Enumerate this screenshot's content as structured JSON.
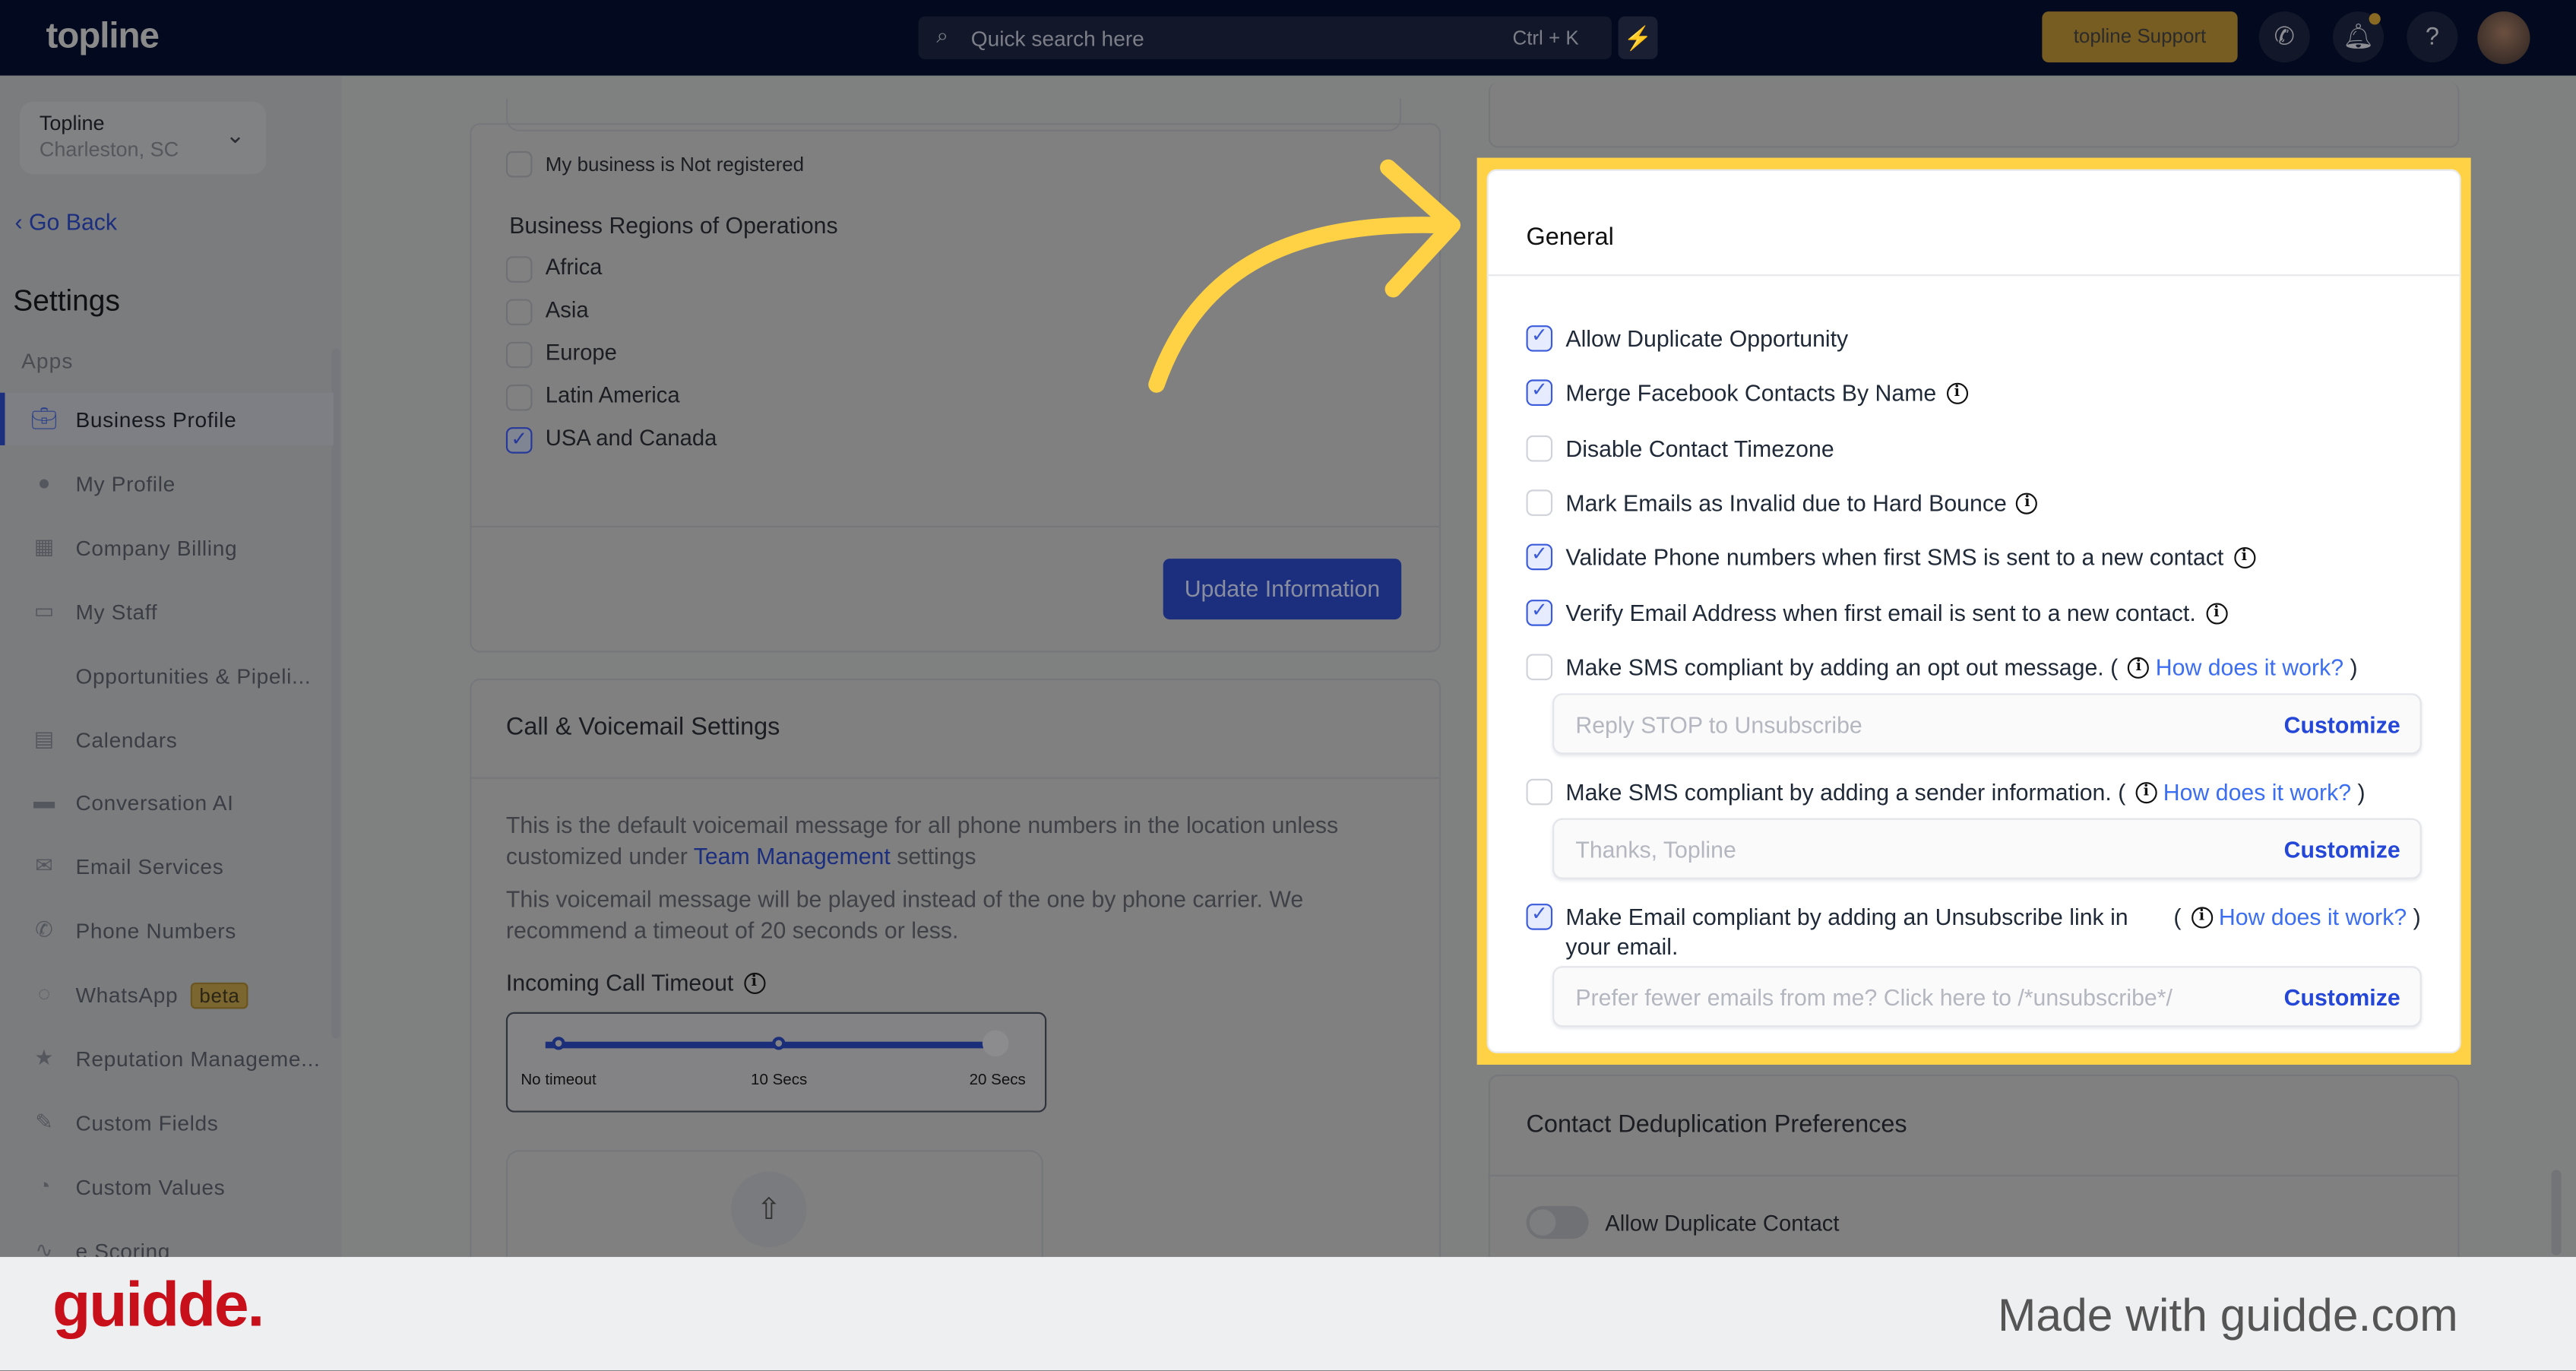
{
  "header": {
    "logo": "topline",
    "search_placeholder": "Quick search here",
    "search_shortcut": "Ctrl + K",
    "support_label": "topline Support",
    "icons": [
      "search-icon",
      "lightning-icon",
      "phone-icon",
      "bell-icon",
      "help-icon",
      "avatar"
    ]
  },
  "sidebar": {
    "location_name": "Topline",
    "location_city": "Charleston, SC",
    "go_back": "Go Back",
    "title": "Settings",
    "section": "Apps",
    "items": [
      {
        "label": "Business Profile",
        "icon": "briefcase-icon",
        "active": true
      },
      {
        "label": "My Profile",
        "icon": "user-icon"
      },
      {
        "label": "Company Billing",
        "icon": "calculator-icon"
      },
      {
        "label": "My Staff",
        "icon": "inbox-icon"
      },
      {
        "label": "Opportunities & Pipeli...",
        "icon": ""
      },
      {
        "label": "Calendars",
        "icon": "calendar-icon"
      },
      {
        "label": "Conversation AI",
        "icon": "chat-icon"
      },
      {
        "label": "Email Services",
        "icon": "mail-icon"
      },
      {
        "label": "Phone Numbers",
        "icon": "phone-icon"
      },
      {
        "label": "WhatsApp",
        "icon": "whatsapp-icon",
        "badge": "beta"
      },
      {
        "label": "Reputation Manageme...",
        "icon": "star-icon"
      },
      {
        "label": "Custom Fields",
        "icon": "edit-field-icon"
      },
      {
        "label": "Custom Values",
        "icon": "pie-icon"
      },
      {
        "label": "e Scoring",
        "icon": "chart-icon"
      }
    ]
  },
  "business": {
    "not_registered": "My business is Not registered",
    "regions_title": "Business Regions of Operations",
    "regions": [
      {
        "label": "Africa",
        "checked": false
      },
      {
        "label": "Asia",
        "checked": false
      },
      {
        "label": "Europe",
        "checked": false
      },
      {
        "label": "Latin America",
        "checked": false
      },
      {
        "label": "USA and Canada",
        "checked": true
      }
    ],
    "update_button": "Update Information"
  },
  "call": {
    "title": "Call & Voicemail Settings",
    "p1_a": "This is the default voicemail message for all phone numbers in the location unless customized under",
    "p1_link": "Team Management",
    "p1_b": "settings",
    "p2": "This voicemail message will be played instead of the one by phone carrier. We recommend a timeout of 20 seconds or less.",
    "timeout_label": "Incoming Call Timeout",
    "ticks": [
      "No timeout",
      "10 Secs",
      "20 Secs"
    ],
    "timeout_value": "20 Secs"
  },
  "general": {
    "title": "General",
    "options": [
      {
        "label": "Allow Duplicate Opportunity",
        "checked": true
      },
      {
        "label": "Merge Facebook Contacts By Name",
        "checked": true,
        "info": true
      },
      {
        "label": "Disable Contact Timezone",
        "checked": false
      },
      {
        "label": "Mark Emails as Invalid due to Hard Bounce",
        "checked": false,
        "info": true
      },
      {
        "label": "Validate Phone numbers when first SMS is sent to a new contact",
        "checked": true,
        "info": true
      },
      {
        "label": "Verify Email Address when first email is sent to a new contact.",
        "checked": true,
        "info": true
      },
      {
        "label": "Make SMS compliant by adding an opt out message.",
        "checked": false,
        "info": true,
        "how": "How does it work?",
        "field_placeholder": "Reply STOP to Unsubscribe",
        "customize": "Customize"
      },
      {
        "label": "Make SMS compliant by adding a sender information.",
        "checked": false,
        "info": true,
        "how": "How does it work?",
        "field_placeholder": "Thanks, Topline",
        "customize": "Customize"
      },
      {
        "label": "Make Email compliant by adding an Unsubscribe link in",
        "label2": "your email.",
        "checked": true,
        "info": true,
        "how": "How does it work?",
        "field_placeholder": "Prefer fewer emails from me? Click here to /*unsubscribe*/",
        "customize": "Customize"
      }
    ]
  },
  "dedup": {
    "title": "Contact Deduplication Preferences",
    "allow_duplicate_contact": "Allow Duplicate Contact",
    "enabled": false
  },
  "footer": {
    "brand": "guidde.",
    "made_with": "Made with guidde.com"
  },
  "colors": {
    "highlight": "#ffd246",
    "accent": "#3b5bdb",
    "link": "#3b6ef0",
    "header": "#030a1f"
  }
}
